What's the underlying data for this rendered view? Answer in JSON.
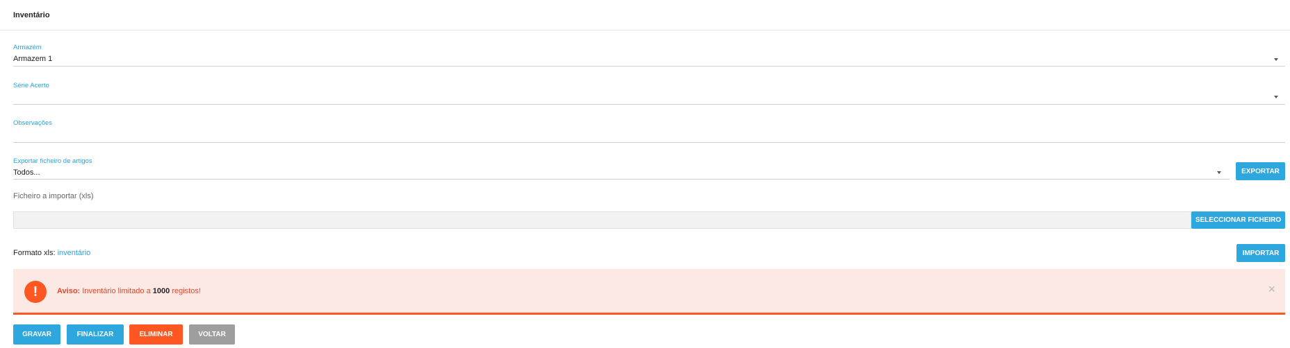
{
  "header": {
    "title": "Inventário"
  },
  "form": {
    "armazem": {
      "label": "Armazém",
      "value": "Armazem 1"
    },
    "serie": {
      "label": "Série Acerto",
      "value": ""
    },
    "observacoes": {
      "label": "Observações",
      "value": ""
    },
    "exportar": {
      "label": "Exportar ficheiro de artigos",
      "value": "Todos...",
      "button": "EXPORTAR"
    },
    "importar": {
      "label": "Ficheiro a importar (xls)",
      "select_button": "SELECCIONAR FICHEIRO",
      "formato_prefix": "Formato xls:",
      "formato_link": "inventário",
      "import_button": "IMPORTAR"
    }
  },
  "alert": {
    "title": "Aviso:",
    "message_pre": " Inventário limitado a ",
    "count": "1000",
    "message_post": " registos!",
    "icon": "!",
    "close": "×"
  },
  "actions": {
    "gravar": "GRAVAR",
    "finalizar": "FINALIZAR",
    "eliminar": "ELIMINAR",
    "voltar": "VOLTAR"
  },
  "colors": {
    "accent": "#2ea7df",
    "danger": "#ff5722",
    "neutral": "#9e9e9e"
  }
}
